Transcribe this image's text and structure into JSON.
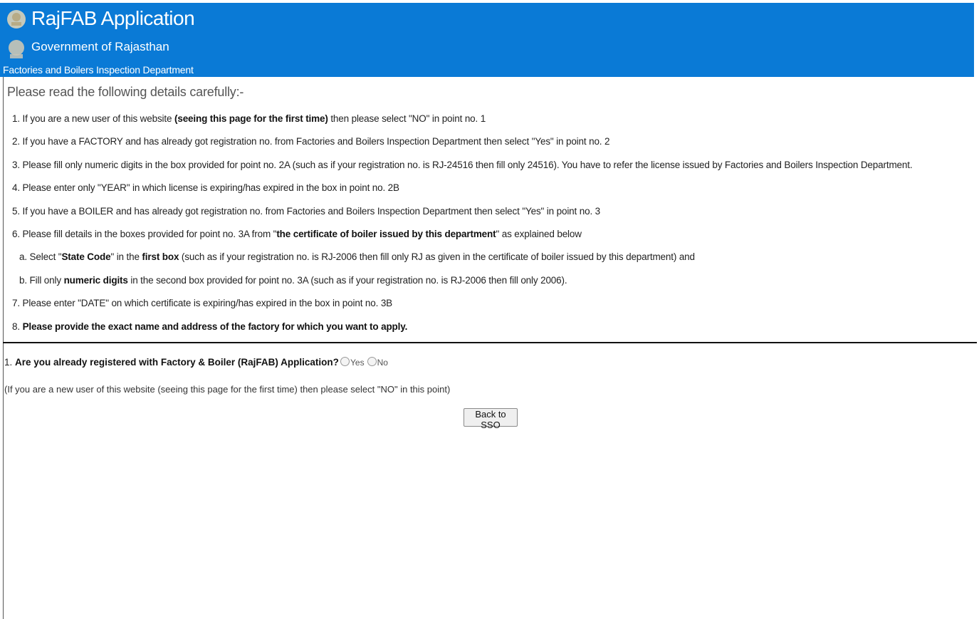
{
  "header": {
    "app_title": "RajFAB Application",
    "gov_title": "Government of Rajasthan",
    "dept_title": "Factories and Boilers Inspection Department",
    "bg_color": "#0a7ad6"
  },
  "intro": "Please read the following details carefully:-",
  "instructions": [
    {
      "pre": "1. If you are a new user of this website ",
      "bold": "(seeing this page for the first time)",
      "post": " then please select \"NO\" in point no. 1"
    },
    {
      "pre": "2. If you have a FACTORY and has already got registration no. from Factories and Boilers Inspection Department then select \"Yes\" in point no. 2"
    },
    {
      "pre": "3. Please fill only numeric digits in the box provided for point no. 2A (such as if your registration no. is RJ-24516 then fill only 24516). You have to refer the license issued by Factories and Boilers Inspection Department."
    },
    {
      "pre": "4. Please enter only \"YEAR\" in which license is expiring/has expired in the box in point no. 2B"
    },
    {
      "pre": "5. If you have a BOILER and has already got registration no. from Factories and Boilers Inspection Department then select \"Yes\" in point no. 3"
    },
    {
      "pre": "6. Please fill details in the boxes provided for point no. 3A from \"",
      "bold": "the certificate of boiler issued by this department",
      "post": "\" as explained below"
    },
    {
      "pre": "a. Select \"",
      "bold": "State Code",
      "mid": "\" in the ",
      "bold2": "first box",
      "post": " (such as if your registration no. is RJ-2006 then fill only RJ as given in the certificate of boiler issued by this department) and"
    },
    {
      "pre": "b. Fill only ",
      "bold": "numeric digits",
      "post": " in the second box provided for point no. 3A (such as if your registration no. is RJ-2006 then fill only 2006)."
    },
    {
      "pre": "7. Please enter \"DATE\" on which certificate is expiring/has expired in the box in point no. 3B"
    },
    {
      "pre": "8. ",
      "bold": "Please provide the exact name and address of the factory for which you want to apply."
    }
  ],
  "question": {
    "number": "1.",
    "text": "Are you already registered with Factory & Boiler (RajFAB) Application?",
    "options": [
      "Yes",
      "No"
    ],
    "note": "(If you are a new user of this website (seeing this page for the first time) then please select \"NO\" in this point)"
  },
  "buttons": {
    "back": "Back to SSO"
  }
}
